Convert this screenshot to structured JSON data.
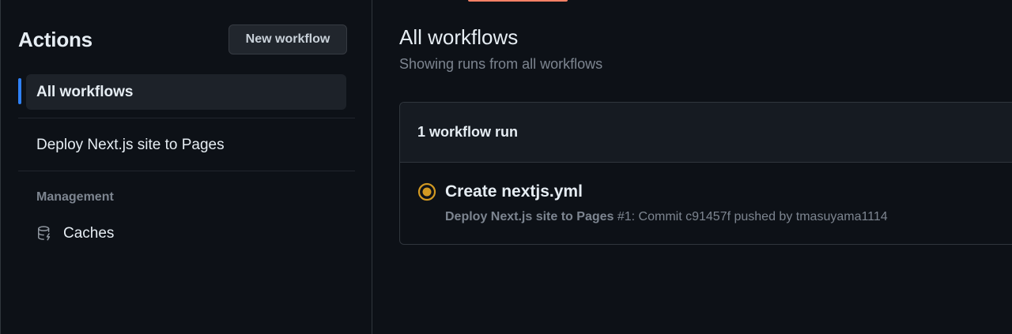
{
  "sidebar": {
    "title": "Actions",
    "new_workflow_label": "New workflow",
    "active_item": "All workflows",
    "workflows": [
      "Deploy Next.js site to Pages"
    ],
    "management_heading": "Management",
    "caches_label": "Caches",
    "caches_icon": "database-lightning-icon"
  },
  "main": {
    "title": "All workflows",
    "subtitle": "Showing runs from all workflows",
    "runs_count": "1 workflow run",
    "runs": [
      {
        "status": "in-progress",
        "status_color": "#d29922",
        "title": "Create nextjs.yml",
        "workflow_name": "Deploy Next.js site to Pages",
        "run_number": "#1",
        "details": ": Commit c91457f pushed by tmasuyama1114"
      }
    ]
  },
  "colors": {
    "accent": "#2f81f7",
    "top_accent": "#f78166",
    "background": "#0d1117"
  }
}
